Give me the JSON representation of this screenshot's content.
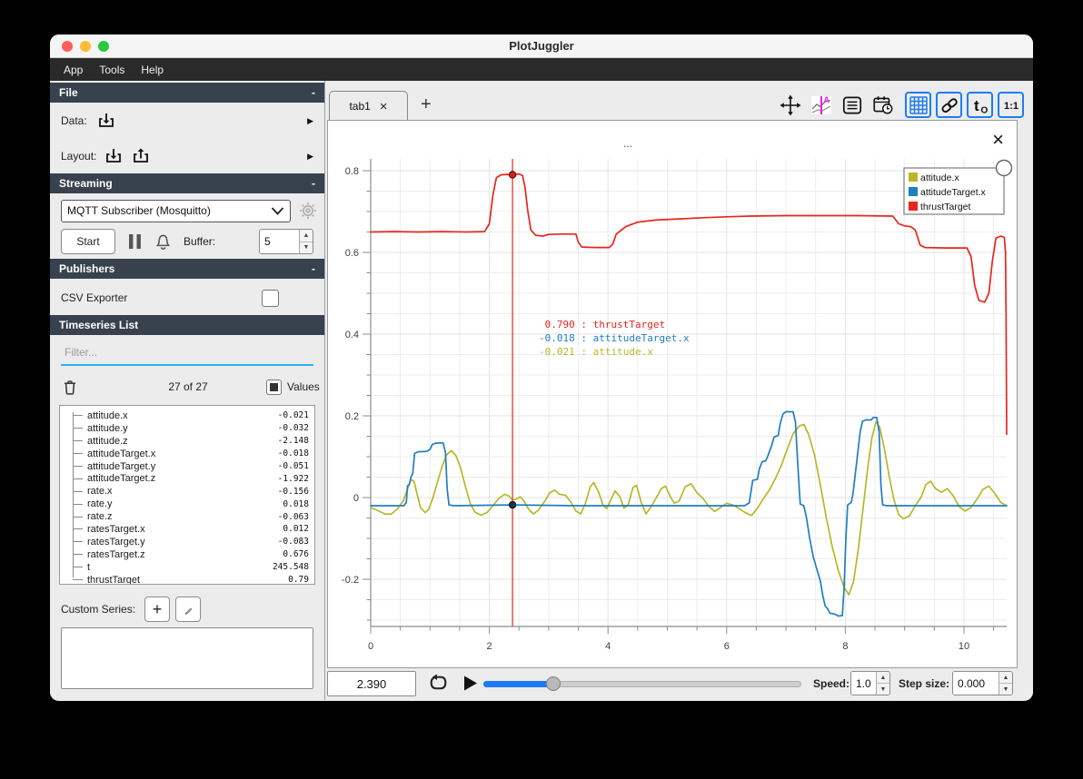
{
  "window": {
    "title": "PlotJuggler"
  },
  "menu": {
    "items": [
      "App",
      "Tools",
      "Help"
    ]
  },
  "colors": {
    "accent_blue": "#1f7cf1",
    "filter_underline": "#2ab6ea",
    "slider_blue": "#1e7bf2",
    "section_header_bg": "#37424e",
    "series_attitude_x": "#b9b62a",
    "series_attitude_target_x": "#1f7ec2",
    "series_thrust_target": "#e8251c"
  },
  "sidebar": {
    "file": {
      "title": "File",
      "collapse_glyph": "-",
      "data_label": "Data:",
      "layout_label": "Layout:"
    },
    "streaming": {
      "title": "Streaming",
      "collapse_glyph": "-",
      "source_selected": "MQTT Subscriber (Mosquitto)",
      "start_label": "Start",
      "buffer_label": "Buffer:",
      "buffer_value": "5"
    },
    "publishers": {
      "title": "Publishers",
      "collapse_glyph": "-",
      "csv_exporter_label": "CSV Exporter"
    },
    "timeseries": {
      "title": "Timeseries List",
      "filter_placeholder": "Filter...",
      "count_label": "27 of 27",
      "values_label": "Values",
      "items": [
        {
          "name": "attitude.x",
          "value": "-0.021"
        },
        {
          "name": "attitude.y",
          "value": "-0.032"
        },
        {
          "name": "attitude.z",
          "value": "-2.148"
        },
        {
          "name": "attitudeTarget.x",
          "value": "-0.018"
        },
        {
          "name": "attitudeTarget.y",
          "value": "-0.051"
        },
        {
          "name": "attitudeTarget.z",
          "value": "-1.922"
        },
        {
          "name": "rate.x",
          "value": "-0.156"
        },
        {
          "name": "rate.y",
          "value": "0.018"
        },
        {
          "name": "rate.z",
          "value": "-0.063"
        },
        {
          "name": "ratesTarget.x",
          "value": "0.012"
        },
        {
          "name": "ratesTarget.y",
          "value": "-0.083"
        },
        {
          "name": "ratesTarget.z",
          "value": "0.676"
        },
        {
          "name": "t",
          "value": "245.548"
        },
        {
          "name": "thrustTarget",
          "value": "0.79"
        }
      ]
    },
    "custom_series_label": "Custom Series:"
  },
  "tabbar": {
    "active_tab": "tab1",
    "close_glyph": "×",
    "add_tab_glyph": "+"
  },
  "plot": {
    "title": "...",
    "close_glyph": "×",
    "legend": [
      {
        "label": "attitude.x",
        "color": "#b9b62a"
      },
      {
        "label": "attitudeTarget.x",
        "color": "#1f7ec2"
      },
      {
        "label": "thrustTarget",
        "color": "#e8251c"
      }
    ],
    "tracker_readout": [
      {
        "value": " 0.790",
        "label": "thrustTarget",
        "color": "#e8251c"
      },
      {
        "value": "-0.018",
        "label": "attitudeTarget.x",
        "color": "#1f7ec2"
      },
      {
        "value": "-0.021",
        "label": "attitude.x",
        "color": "#b9b62a"
      }
    ]
  },
  "playback": {
    "time_value": "2.390",
    "speed_label": "Speed:",
    "speed_value": "1.0",
    "step_label": "Step size:",
    "step_value": "0.000"
  },
  "chart_data": {
    "type": "line",
    "title": "...",
    "xlabel": "",
    "ylabel": "",
    "x_range": [
      0,
      10.72
    ],
    "y_range": [
      -0.316,
      0.829
    ],
    "x_ticks": [
      0,
      2,
      4,
      6,
      8,
      10
    ],
    "y_ticks": [
      0.8,
      0.6,
      0.4,
      0.2,
      0,
      -0.2
    ],
    "x_minor_step": 0.5,
    "y_minor_step": 0.05,
    "grid": true,
    "legend_position": "top-right",
    "cursor": {
      "t": 2.39,
      "color": "#e8251c",
      "markers": [
        {
          "series": "thrustTarget",
          "v": 0.79,
          "fill": "#d42018",
          "stroke": "#5e0f0c"
        },
        {
          "series": "attitudeTarget.x",
          "v": -0.018,
          "fill": "#14334d",
          "stroke": "#0a1826"
        }
      ]
    },
    "series": [
      {
        "name": "attitude.x",
        "color": "#b9b62a",
        "points": [
          [
            0,
            -0.024
          ],
          [
            0.12,
            -0.032
          ],
          [
            0.25,
            -0.041
          ],
          [
            0.35,
            -0.04
          ],
          [
            0.45,
            -0.028
          ],
          [
            0.55,
            -0.008
          ],
          [
            0.63,
            0.025
          ],
          [
            0.68,
            0.044
          ],
          [
            0.73,
            0.04
          ],
          [
            0.78,
            0.01
          ],
          [
            0.84,
            -0.025
          ],
          [
            0.92,
            -0.037
          ],
          [
            0.98,
            -0.028
          ],
          [
            1.05,
            0
          ],
          [
            1.12,
            0.035
          ],
          [
            1.2,
            0.075
          ],
          [
            1.28,
            0.105
          ],
          [
            1.36,
            0.115
          ],
          [
            1.44,
            0.102
          ],
          [
            1.52,
            0.07
          ],
          [
            1.6,
            0.025
          ],
          [
            1.68,
            -0.015
          ],
          [
            1.76,
            -0.036
          ],
          [
            1.86,
            -0.043
          ],
          [
            1.96,
            -0.037
          ],
          [
            2.06,
            -0.02
          ],
          [
            2.16,
            -0.002
          ],
          [
            2.26,
            0.008
          ],
          [
            2.33,
            0.004
          ],
          [
            2.39,
            -0.006
          ],
          [
            2.45,
            -0.004
          ],
          [
            2.52,
            0.002
          ],
          [
            2.58,
            -0.008
          ],
          [
            2.66,
            -0.028
          ],
          [
            2.74,
            -0.04
          ],
          [
            2.82,
            -0.032
          ],
          [
            2.92,
            -0.012
          ],
          [
            3.02,
            0.012
          ],
          [
            3.1,
            0.018
          ],
          [
            3.18,
            0.008
          ],
          [
            3.28,
            0.006
          ],
          [
            3.38,
            -0.012
          ],
          [
            3.46,
            -0.033
          ],
          [
            3.54,
            -0.04
          ],
          [
            3.62,
            -0.014
          ],
          [
            3.7,
            0.026
          ],
          [
            3.76,
            0.037
          ],
          [
            3.84,
            0.014
          ],
          [
            3.92,
            -0.02
          ],
          [
            3.98,
            -0.027
          ],
          [
            4.06,
            -0.002
          ],
          [
            4.12,
            0.016
          ],
          [
            4.2,
            0.002
          ],
          [
            4.27,
            -0.026
          ],
          [
            4.34,
            -0.018
          ],
          [
            4.42,
            0.024
          ],
          [
            4.48,
            0.03
          ],
          [
            4.56,
            -0.012
          ],
          [
            4.64,
            -0.04
          ],
          [
            4.72,
            -0.024
          ],
          [
            4.8,
            -0.004
          ],
          [
            4.9,
            0.022
          ],
          [
            4.97,
            0.028
          ],
          [
            5.05,
            0.002
          ],
          [
            5.12,
            -0.014
          ],
          [
            5.2,
            -0.008
          ],
          [
            5.3,
            0.026
          ],
          [
            5.4,
            0.034
          ],
          [
            5.5,
            0.012
          ],
          [
            5.6,
            -0.002
          ],
          [
            5.7,
            -0.022
          ],
          [
            5.8,
            -0.034
          ],
          [
            5.9,
            -0.024
          ],
          [
            6,
            -0.014
          ],
          [
            6.1,
            -0.018
          ],
          [
            6.2,
            -0.026
          ],
          [
            6.3,
            -0.036
          ],
          [
            6.42,
            -0.044
          ],
          [
            6.52,
            -0.026
          ],
          [
            6.62,
            -0.002
          ],
          [
            6.72,
            0.018
          ],
          [
            6.82,
            0.046
          ],
          [
            6.92,
            0.078
          ],
          [
            7.02,
            0.118
          ],
          [
            7.12,
            0.156
          ],
          [
            7.22,
            0.175
          ],
          [
            7.3,
            0.179
          ],
          [
            7.38,
            0.155
          ],
          [
            7.48,
            0.105
          ],
          [
            7.58,
            0.03
          ],
          [
            7.68,
            -0.05
          ],
          [
            7.78,
            -0.12
          ],
          [
            7.88,
            -0.178
          ],
          [
            7.98,
            -0.22
          ],
          [
            8.06,
            -0.238
          ],
          [
            8.14,
            -0.205
          ],
          [
            8.22,
            -0.125
          ],
          [
            8.3,
            -0.025
          ],
          [
            8.38,
            0.075
          ],
          [
            8.45,
            0.148
          ],
          [
            8.52,
            0.186
          ],
          [
            8.58,
            0.172
          ],
          [
            8.66,
            0.118
          ],
          [
            8.74,
            0.052
          ],
          [
            8.82,
            -0.005
          ],
          [
            8.9,
            -0.042
          ],
          [
            8.98,
            -0.052
          ],
          [
            9.08,
            -0.045
          ],
          [
            9.18,
            -0.02
          ],
          [
            9.28,
            0.002
          ],
          [
            9.36,
            0.032
          ],
          [
            9.44,
            0.04
          ],
          [
            9.52,
            0.022
          ],
          [
            9.62,
            0.013
          ],
          [
            9.72,
            0.022
          ],
          [
            9.82,
            0.004
          ],
          [
            9.92,
            -0.022
          ],
          [
            10.02,
            -0.033
          ],
          [
            10.12,
            -0.024
          ],
          [
            10.22,
            -0.004
          ],
          [
            10.32,
            0.02
          ],
          [
            10.42,
            0.028
          ],
          [
            10.52,
            0.01
          ],
          [
            10.62,
            -0.012
          ],
          [
            10.72,
            -0.02
          ]
        ]
      },
      {
        "name": "attitudeTarget.x",
        "color": "#1f7ec2",
        "points": [
          [
            0,
            -0.02
          ],
          [
            0.56,
            -0.02
          ],
          [
            0.6,
            -0.012
          ],
          [
            0.62,
            0.028
          ],
          [
            0.65,
            0.032
          ],
          [
            0.68,
            0.05
          ],
          [
            0.71,
            0.06
          ],
          [
            0.74,
            0.108
          ],
          [
            0.8,
            0.112
          ],
          [
            0.95,
            0.113
          ],
          [
            1,
            0.118
          ],
          [
            1.04,
            0.13
          ],
          [
            1.1,
            0.133
          ],
          [
            1.22,
            0.134
          ],
          [
            1.26,
            0.11
          ],
          [
            1.29,
            0.02
          ],
          [
            1.32,
            -0.018
          ],
          [
            1.4,
            -0.02
          ],
          [
            2.39,
            -0.018
          ],
          [
            3.5,
            -0.02
          ],
          [
            5,
            -0.02
          ],
          [
            6.3,
            -0.02
          ],
          [
            6.38,
            -0.013
          ],
          [
            6.41,
            0.015
          ],
          [
            6.44,
            0.042
          ],
          [
            6.52,
            0.045
          ],
          [
            6.55,
            0.07
          ],
          [
            6.6,
            0.088
          ],
          [
            6.66,
            0.09
          ],
          [
            6.7,
            0.104
          ],
          [
            6.76,
            0.128
          ],
          [
            6.8,
            0.148
          ],
          [
            6.87,
            0.152
          ],
          [
            6.9,
            0.18
          ],
          [
            6.95,
            0.205
          ],
          [
            7,
            0.21
          ],
          [
            7.12,
            0.21
          ],
          [
            7.16,
            0.185
          ],
          [
            7.2,
            0.08
          ],
          [
            7.24,
            -0.016
          ],
          [
            7.3,
            -0.02
          ],
          [
            7.34,
            -0.045
          ],
          [
            7.4,
            -0.1
          ],
          [
            7.46,
            -0.145
          ],
          [
            7.52,
            -0.175
          ],
          [
            7.58,
            -0.205
          ],
          [
            7.62,
            -0.24
          ],
          [
            7.66,
            -0.265
          ],
          [
            7.7,
            -0.272
          ],
          [
            7.74,
            -0.283
          ],
          [
            7.82,
            -0.285
          ],
          [
            7.88,
            -0.29
          ],
          [
            7.95,
            -0.289
          ],
          [
            7.98,
            -0.22
          ],
          [
            8.01,
            -0.1
          ],
          [
            8.04,
            -0.018
          ],
          [
            8.1,
            -0.012
          ],
          [
            8.13,
            0.01
          ],
          [
            8.17,
            0.06
          ],
          [
            8.21,
            0.11
          ],
          [
            8.25,
            0.16
          ],
          [
            8.29,
            0.187
          ],
          [
            8.35,
            0.19
          ],
          [
            8.44,
            0.19
          ],
          [
            8.47,
            0.196
          ],
          [
            8.53,
            0.196
          ],
          [
            8.57,
            0.16
          ],
          [
            8.6,
            0.03
          ],
          [
            8.63,
            -0.018
          ],
          [
            8.7,
            -0.02
          ],
          [
            9.5,
            -0.02
          ],
          [
            10.72,
            -0.02
          ]
        ]
      },
      {
        "name": "thrustTarget",
        "color": "#e8251c",
        "points": [
          [
            0,
            0.65
          ],
          [
            0.4,
            0.651
          ],
          [
            0.8,
            0.65
          ],
          [
            1.2,
            0.651
          ],
          [
            1.6,
            0.65
          ],
          [
            1.92,
            0.651
          ],
          [
            2,
            0.67
          ],
          [
            2.06,
            0.74
          ],
          [
            2.12,
            0.783
          ],
          [
            2.2,
            0.79
          ],
          [
            2.3,
            0.791
          ],
          [
            2.39,
            0.79
          ],
          [
            2.5,
            0.792
          ],
          [
            2.56,
            0.788
          ],
          [
            2.6,
            0.76
          ],
          [
            2.65,
            0.7
          ],
          [
            2.7,
            0.655
          ],
          [
            2.78,
            0.642
          ],
          [
            2.9,
            0.64
          ],
          [
            3,
            0.644
          ],
          [
            3.2,
            0.645
          ],
          [
            3.46,
            0.645
          ],
          [
            3.5,
            0.625
          ],
          [
            3.56,
            0.613
          ],
          [
            3.8,
            0.612
          ],
          [
            4.02,
            0.612
          ],
          [
            4.08,
            0.62
          ],
          [
            4.14,
            0.645
          ],
          [
            4.3,
            0.663
          ],
          [
            4.5,
            0.674
          ],
          [
            4.8,
            0.679
          ],
          [
            5.2,
            0.682
          ],
          [
            5.6,
            0.685
          ],
          [
            6,
            0.687
          ],
          [
            6.4,
            0.689
          ],
          [
            7,
            0.69
          ],
          [
            7.6,
            0.69
          ],
          [
            8.2,
            0.69
          ],
          [
            8.8,
            0.689
          ],
          [
            8.9,
            0.67
          ],
          [
            9,
            0.665
          ],
          [
            9.1,
            0.663
          ],
          [
            9.18,
            0.655
          ],
          [
            9.26,
            0.618
          ],
          [
            9.34,
            0.612
          ],
          [
            9.7,
            0.611
          ],
          [
            10.05,
            0.611
          ],
          [
            10.12,
            0.59
          ],
          [
            10.18,
            0.52
          ],
          [
            10.25,
            0.483
          ],
          [
            10.35,
            0.478
          ],
          [
            10.42,
            0.5
          ],
          [
            10.48,
            0.58
          ],
          [
            10.54,
            0.635
          ],
          [
            10.62,
            0.64
          ],
          [
            10.68,
            0.637
          ],
          [
            10.7,
            0.6
          ],
          [
            10.71,
            0.45
          ],
          [
            10.72,
            0.155
          ]
        ]
      }
    ]
  }
}
